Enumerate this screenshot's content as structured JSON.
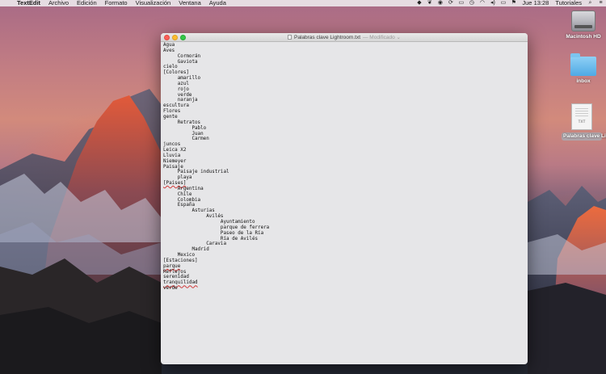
{
  "menubar": {
    "apple": "",
    "app_name": "TextEdit",
    "menus": [
      "Archivo",
      "Edición",
      "Formato",
      "Visualización",
      "Ventana",
      "Ayuda"
    ],
    "clock": "Jue 13:28",
    "user": "Tutoriales",
    "status_icons": [
      "dropbox-icon",
      "evernote-icon",
      "screen-record-icon",
      "sync-icon",
      "display-icon",
      "time-machine-icon",
      "wifi-icon",
      "volume-icon",
      "battery-icon",
      "flag-icon"
    ]
  },
  "desktop": {
    "icons": [
      {
        "label": "Macintosh HD",
        "icon": "hard-drive-icon"
      },
      {
        "label": "inbox",
        "icon": "folder-icon"
      },
      {
        "label": "Palabras clave Lightroom.txt",
        "icon": "text-file-icon",
        "badge": "TXT"
      }
    ]
  },
  "window": {
    "title": "Palabras clave Lightroom.txt",
    "status": "— Modificado ⌄",
    "lines": [
      "Agua",
      "Aves",
      "\tCormorán",
      "\tGaviota",
      "cielo",
      "[Colores]",
      "\tamarillo",
      "\tazul",
      "\trojo",
      "\tverde",
      "\tnaranja",
      "escultura",
      "Flores",
      "gente",
      "\tRetratos",
      "\t\tPablo",
      "\t\tJuan",
      "\t\tCarmen",
      "juncos",
      "Leica X2",
      "Lluvia",
      "Niemeyer",
      "Paisaje",
      "\tPaisaje industrial",
      "\tplaya",
      "[Paises]",
      "\tArgentina",
      "\tChile",
      "\tColombia",
      "\tEspaña",
      "\t\tAsturias",
      "\t\t\tAvilés",
      "\t\t\t\tAyuntamiento",
      "\t\t\t\tparque de ferrera",
      "\t\t\t\tPaseo de la Ría",
      "\t\t\t\tRía de Avilés",
      "\t\t\tCaravia",
      "\t\tMadrid",
      "\tMexico",
      "[Estaciones]",
      "parque",
      "Reflejos",
      "serenidad",
      "tranquilidad",
      "verde"
    ],
    "misspelled_lines": [
      25,
      40,
      43
    ]
  }
}
